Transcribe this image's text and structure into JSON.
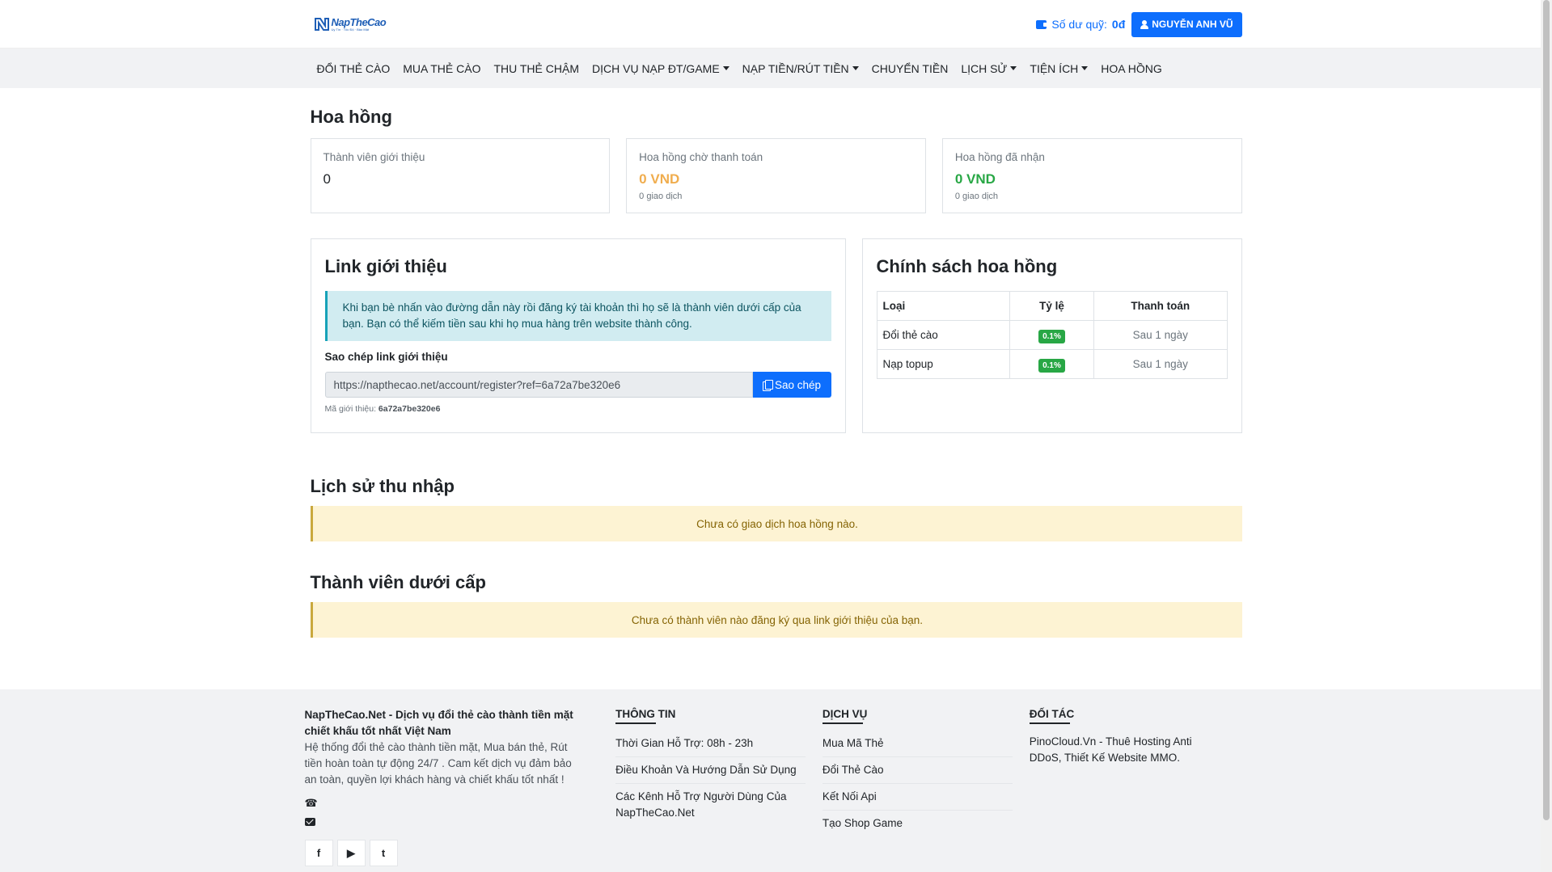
{
  "header": {
    "logo_name": "NapTheCao",
    "logo_tagline": "Uy Tín · Tốc Độ · Bảo Mật",
    "balance_label": "Số dư quỹ:",
    "balance_value": "0đ",
    "user_name": "NGUYỄN ANH VŨ"
  },
  "nav": {
    "items": [
      {
        "label": "ĐỔI THẺ CÀO",
        "dropdown": false
      },
      {
        "label": "MUA THẺ CÀO",
        "dropdown": false
      },
      {
        "label": "THU THẺ CHẬM",
        "dropdown": false
      },
      {
        "label": "DỊCH VỤ NẠP ĐT/GAME",
        "dropdown": true
      },
      {
        "label": "NẠP TIỀN/RÚT TIỀN",
        "dropdown": true
      },
      {
        "label": "CHUYỂN TIỀN",
        "dropdown": false
      },
      {
        "label": "LỊCH SỬ",
        "dropdown": true
      },
      {
        "label": "TIỆN ÍCH",
        "dropdown": true
      },
      {
        "label": "HOA HỒNG",
        "dropdown": false
      }
    ]
  },
  "page": {
    "title": "Hoa hồng"
  },
  "stats": [
    {
      "label": "Thành viên giới thiệu",
      "value": "0",
      "sub": ""
    },
    {
      "label": "Hoa hồng chờ thanh toán",
      "value": "0 VND",
      "sub": "0 giao dịch"
    },
    {
      "label": "Hoa hồng đã nhận",
      "value": "0 VND",
      "sub": "0 giao dịch"
    }
  ],
  "referral": {
    "title": "Link giới thiệu",
    "info": "Khi bạn bè nhấn vào đường dẫn này rồi đăng ký tài khoản thì họ sẽ là thành viên dưới cấp của bạn. Bạn có thể kiếm tiền sau khi họ mua hàng trên website thành công.",
    "copy_label": "Sao chép link giới thiệu",
    "link": "https://napthecao.net/account/register?ref=6a72a7be320e6",
    "copy_button": "Sao chép",
    "code_label": "Mã giới thiệu:",
    "code_value": "6a72a7be320e6"
  },
  "policy": {
    "title": "Chính sách hoa hồng",
    "headers": [
      "Loại",
      "Tỷ lệ",
      "Thanh toán"
    ],
    "rows": [
      {
        "type": "Đổi thẻ cào",
        "rate": "0.1%",
        "payment": "Sau 1 ngày"
      },
      {
        "type": "Nạp topup",
        "rate": "0.1%",
        "payment": "Sau 1 ngày"
      }
    ]
  },
  "income_history": {
    "title": "Lịch sử thu nhập",
    "empty": "Chưa có giao dịch hoa hồng nào."
  },
  "members": {
    "title": "Thành viên dưới cấp",
    "empty": "Chưa có thành viên nào đăng ký qua link giới thiệu của bạn."
  },
  "footer": {
    "about_title": "NapTheCao.Net - Dịch vụ đổi thẻ cào thành tiền mặt chiết khấu tốt nhất Việt Nam",
    "about_desc": "Hệ thống đổi thẻ cào thành tiền mặt, Mua bán thẻ, Rút tiền hoàn toàn tự động 24/7 . Cam kết dịch vụ đảm bảo an toàn, quyền lợi khách hàng và chiết khấu tốt nhất !",
    "socials": [
      "f",
      "▶",
      "t"
    ],
    "info_title": "THÔNG TIN",
    "info_items": [
      "Thời Gian Hỗ Trợ: 08h - 23h",
      "Điều Khoản Và Hướng Dẫn Sử Dụng",
      "Các Kênh Hỗ Trợ Người Dùng Của NapTheCao.Net"
    ],
    "service_title": "DỊCH VỤ",
    "service_items": [
      "Mua Mã Thẻ",
      "Đổi Thẻ Cào",
      "Kết Nối Api",
      "Tạo Shop Game"
    ],
    "partner_title": "ĐỐI TÁC",
    "partner_text": "PinoCloud.Vn - Thuê Hosting Anti DDoS, Thiết Kế Website MMO."
  },
  "colors": {
    "primary": "#0d6efd",
    "pending": "#f0ad4e",
    "received": "#28a745",
    "info_bg": "#d1ecf1",
    "warning_bg": "#fdf3d3"
  }
}
